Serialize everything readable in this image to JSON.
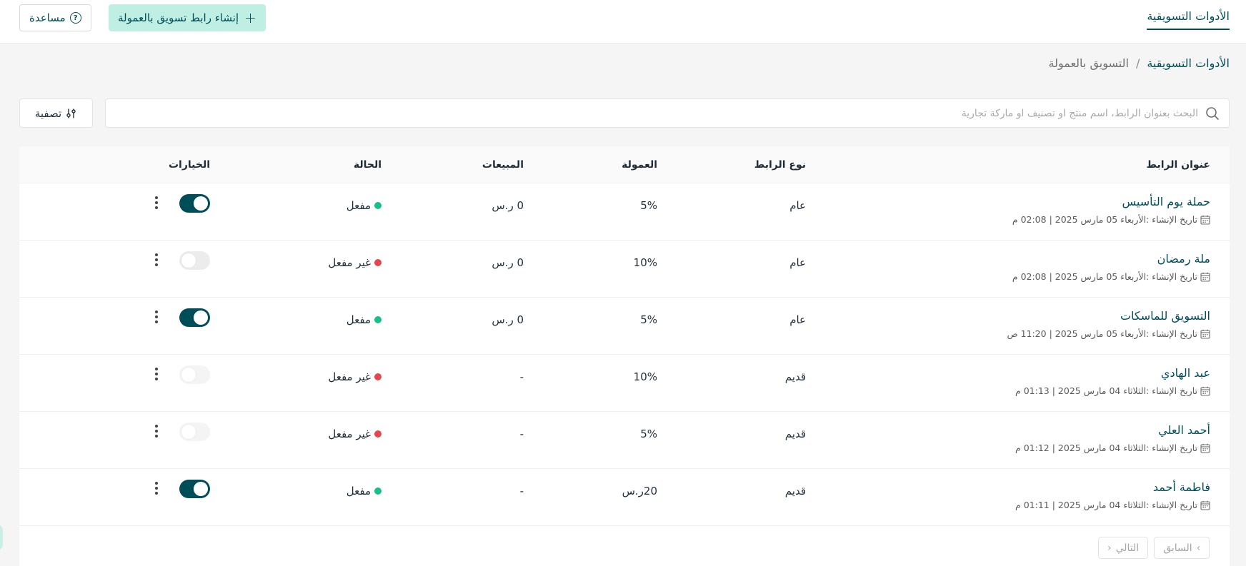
{
  "topbar": {
    "tab_label": "الأدوات التسويقية",
    "create_button_label": "إنشاء رابط تسويق بالعمولة",
    "help_button_label": "مساعدة"
  },
  "breadcrumb": {
    "root": "الأدوات التسويقية",
    "separator": "/",
    "current": "التسويق بالعمولة"
  },
  "search": {
    "placeholder": "البحث بعنوان الرابط، اسم منتج او تصنيف او ماركة تجارية"
  },
  "filter": {
    "label": "تصفية"
  },
  "table": {
    "columns": {
      "title": "عنوان الرابط",
      "type": "نوع الرابط",
      "commission": "العمولة",
      "sales": "المبيعات",
      "status": "الحالة",
      "options": "الخيارات"
    },
    "rows": [
      {
        "title": "حملة يوم التأسيس",
        "date": "تاريخ الإنشاء :الأربعاء 05 مارس 2025 | 02:08 م",
        "type": "عام",
        "commission": "5%",
        "sales": "0 ر.س",
        "status": "مفعل",
        "active": true
      },
      {
        "title": "ملة رمضان",
        "date": "تاريخ الإنشاء :الأربعاء 05 مارس 2025 | 02:08 م",
        "type": "عام",
        "commission": "10%",
        "sales": "0 ر.س",
        "status": "غير مفعل",
        "active": false
      },
      {
        "title": "التسويق للماسكات",
        "date": "تاريخ الإنشاء :الأربعاء 05 مارس 2025 | 11:20 ص",
        "type": "عام",
        "commission": "5%",
        "sales": "0 ر.س",
        "status": "مفعل",
        "active": true
      },
      {
        "title": "عبد الهادي",
        "date": "تاريخ الإنشاء :الثلاثاء 04 مارس 2025 | 01:13 م",
        "type": "قديم",
        "commission": "10%",
        "sales": "-",
        "status": "غير مفعل",
        "active": false
      },
      {
        "title": "أحمد العلي",
        "date": "تاريخ الإنشاء :الثلاثاء 04 مارس 2025 | 01:12 م",
        "type": "قديم",
        "commission": "5%",
        "sales": "-",
        "status": "غير مفعل",
        "active": false
      },
      {
        "title": "فاطمة أحمد",
        "date": "تاريخ الإنشاء :الثلاثاء 04 مارس 2025 | 01:11 م",
        "type": "قديم",
        "commission": "20ر.س",
        "sales": "-",
        "status": "مفعل",
        "active": true
      }
    ]
  },
  "pagination": {
    "prev_label": "السابق",
    "next_label": "التالي"
  },
  "colors": {
    "brand": "#004d5a",
    "create_button_bg": "#bfeee2",
    "active_dot": "#16c08a",
    "inactive_dot": "#e8464f"
  }
}
